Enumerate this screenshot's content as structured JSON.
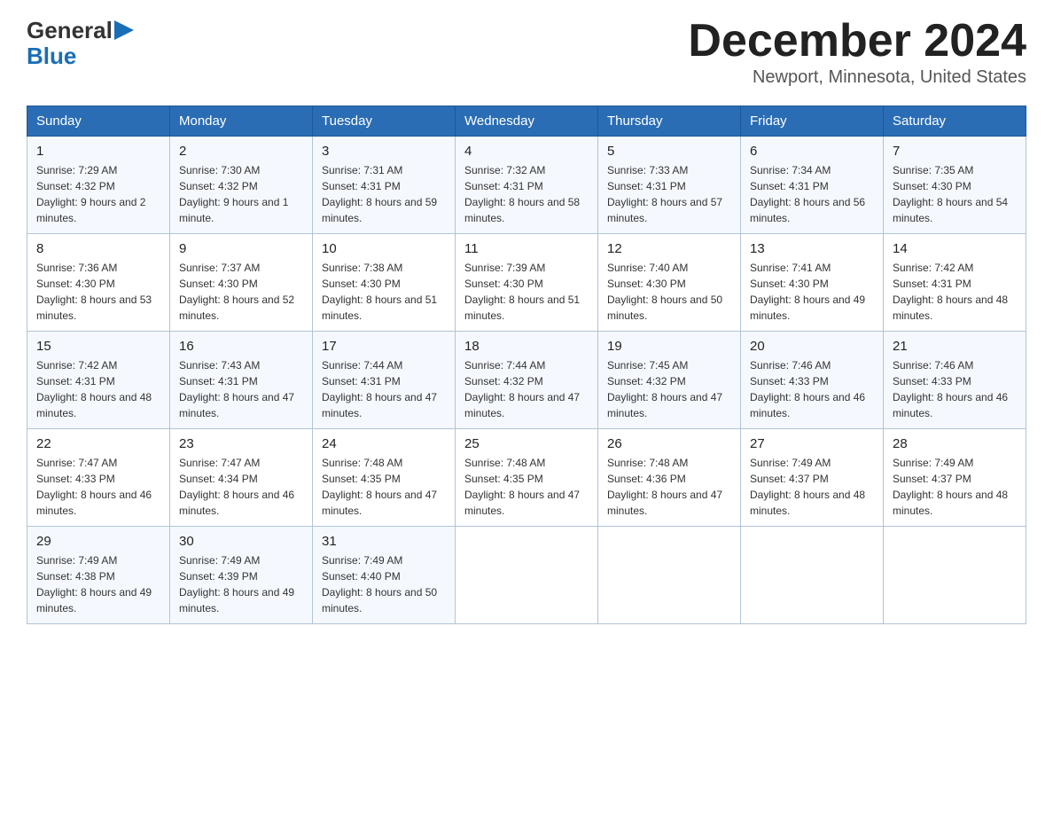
{
  "header": {
    "logo_general": "General",
    "logo_blue": "Blue",
    "month_title": "December 2024",
    "location": "Newport, Minnesota, United States"
  },
  "weekdays": [
    "Sunday",
    "Monday",
    "Tuesday",
    "Wednesday",
    "Thursday",
    "Friday",
    "Saturday"
  ],
  "weeks": [
    [
      {
        "day": "1",
        "sunrise": "7:29 AM",
        "sunset": "4:32 PM",
        "daylight": "9 hours and 2 minutes."
      },
      {
        "day": "2",
        "sunrise": "7:30 AM",
        "sunset": "4:32 PM",
        "daylight": "9 hours and 1 minute."
      },
      {
        "day": "3",
        "sunrise": "7:31 AM",
        "sunset": "4:31 PM",
        "daylight": "8 hours and 59 minutes."
      },
      {
        "day": "4",
        "sunrise": "7:32 AM",
        "sunset": "4:31 PM",
        "daylight": "8 hours and 58 minutes."
      },
      {
        "day": "5",
        "sunrise": "7:33 AM",
        "sunset": "4:31 PM",
        "daylight": "8 hours and 57 minutes."
      },
      {
        "day": "6",
        "sunrise": "7:34 AM",
        "sunset": "4:31 PM",
        "daylight": "8 hours and 56 minutes."
      },
      {
        "day": "7",
        "sunrise": "7:35 AM",
        "sunset": "4:30 PM",
        "daylight": "8 hours and 54 minutes."
      }
    ],
    [
      {
        "day": "8",
        "sunrise": "7:36 AM",
        "sunset": "4:30 PM",
        "daylight": "8 hours and 53 minutes."
      },
      {
        "day": "9",
        "sunrise": "7:37 AM",
        "sunset": "4:30 PM",
        "daylight": "8 hours and 52 minutes."
      },
      {
        "day": "10",
        "sunrise": "7:38 AM",
        "sunset": "4:30 PM",
        "daylight": "8 hours and 51 minutes."
      },
      {
        "day": "11",
        "sunrise": "7:39 AM",
        "sunset": "4:30 PM",
        "daylight": "8 hours and 51 minutes."
      },
      {
        "day": "12",
        "sunrise": "7:40 AM",
        "sunset": "4:30 PM",
        "daylight": "8 hours and 50 minutes."
      },
      {
        "day": "13",
        "sunrise": "7:41 AM",
        "sunset": "4:30 PM",
        "daylight": "8 hours and 49 minutes."
      },
      {
        "day": "14",
        "sunrise": "7:42 AM",
        "sunset": "4:31 PM",
        "daylight": "8 hours and 48 minutes."
      }
    ],
    [
      {
        "day": "15",
        "sunrise": "7:42 AM",
        "sunset": "4:31 PM",
        "daylight": "8 hours and 48 minutes."
      },
      {
        "day": "16",
        "sunrise": "7:43 AM",
        "sunset": "4:31 PM",
        "daylight": "8 hours and 47 minutes."
      },
      {
        "day": "17",
        "sunrise": "7:44 AM",
        "sunset": "4:31 PM",
        "daylight": "8 hours and 47 minutes."
      },
      {
        "day": "18",
        "sunrise": "7:44 AM",
        "sunset": "4:32 PM",
        "daylight": "8 hours and 47 minutes."
      },
      {
        "day": "19",
        "sunrise": "7:45 AM",
        "sunset": "4:32 PM",
        "daylight": "8 hours and 47 minutes."
      },
      {
        "day": "20",
        "sunrise": "7:46 AM",
        "sunset": "4:33 PM",
        "daylight": "8 hours and 46 minutes."
      },
      {
        "day": "21",
        "sunrise": "7:46 AM",
        "sunset": "4:33 PM",
        "daylight": "8 hours and 46 minutes."
      }
    ],
    [
      {
        "day": "22",
        "sunrise": "7:47 AM",
        "sunset": "4:33 PM",
        "daylight": "8 hours and 46 minutes."
      },
      {
        "day": "23",
        "sunrise": "7:47 AM",
        "sunset": "4:34 PM",
        "daylight": "8 hours and 46 minutes."
      },
      {
        "day": "24",
        "sunrise": "7:48 AM",
        "sunset": "4:35 PM",
        "daylight": "8 hours and 47 minutes."
      },
      {
        "day": "25",
        "sunrise": "7:48 AM",
        "sunset": "4:35 PM",
        "daylight": "8 hours and 47 minutes."
      },
      {
        "day": "26",
        "sunrise": "7:48 AM",
        "sunset": "4:36 PM",
        "daylight": "8 hours and 47 minutes."
      },
      {
        "day": "27",
        "sunrise": "7:49 AM",
        "sunset": "4:37 PM",
        "daylight": "8 hours and 48 minutes."
      },
      {
        "day": "28",
        "sunrise": "7:49 AM",
        "sunset": "4:37 PM",
        "daylight": "8 hours and 48 minutes."
      }
    ],
    [
      {
        "day": "29",
        "sunrise": "7:49 AM",
        "sunset": "4:38 PM",
        "daylight": "8 hours and 49 minutes."
      },
      {
        "day": "30",
        "sunrise": "7:49 AM",
        "sunset": "4:39 PM",
        "daylight": "8 hours and 49 minutes."
      },
      {
        "day": "31",
        "sunrise": "7:49 AM",
        "sunset": "4:40 PM",
        "daylight": "8 hours and 50 minutes."
      },
      null,
      null,
      null,
      null
    ]
  ],
  "labels": {
    "sunrise": "Sunrise:",
    "sunset": "Sunset:",
    "daylight": "Daylight:"
  }
}
